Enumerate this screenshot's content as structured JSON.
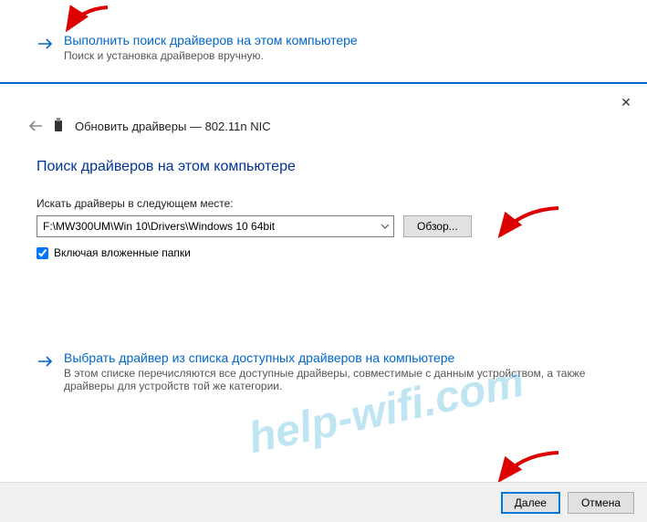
{
  "top_option": {
    "title": "Выполнить поиск драйверов на этом компьютере",
    "subtitle": "Поиск и установка драйверов вручную."
  },
  "dialog": {
    "header_prefix": "Обновить драйверы — ",
    "device_name": "802.11n NIC",
    "section_title": "Поиск драйверов на этом компьютере",
    "path_label": "Искать драйверы в следующем месте:",
    "path_value": "F:\\MW300UM\\Win 10\\Drivers\\Windows 10 64bit",
    "browse_label": "Обзор...",
    "include_sub_label": "Включая вложенные папки",
    "include_sub_checked": true,
    "option2_title": "Выбрать драйвер из списка доступных драйверов на компьютере",
    "option2_sub": "В этом списке перечисляются все доступные драйверы, совместимые с данным устройством, а также драйверы для устройств той же категории."
  },
  "footer": {
    "next_label": "Далее",
    "cancel_label": "Отмена"
  },
  "watermark": "help-wifi.com"
}
